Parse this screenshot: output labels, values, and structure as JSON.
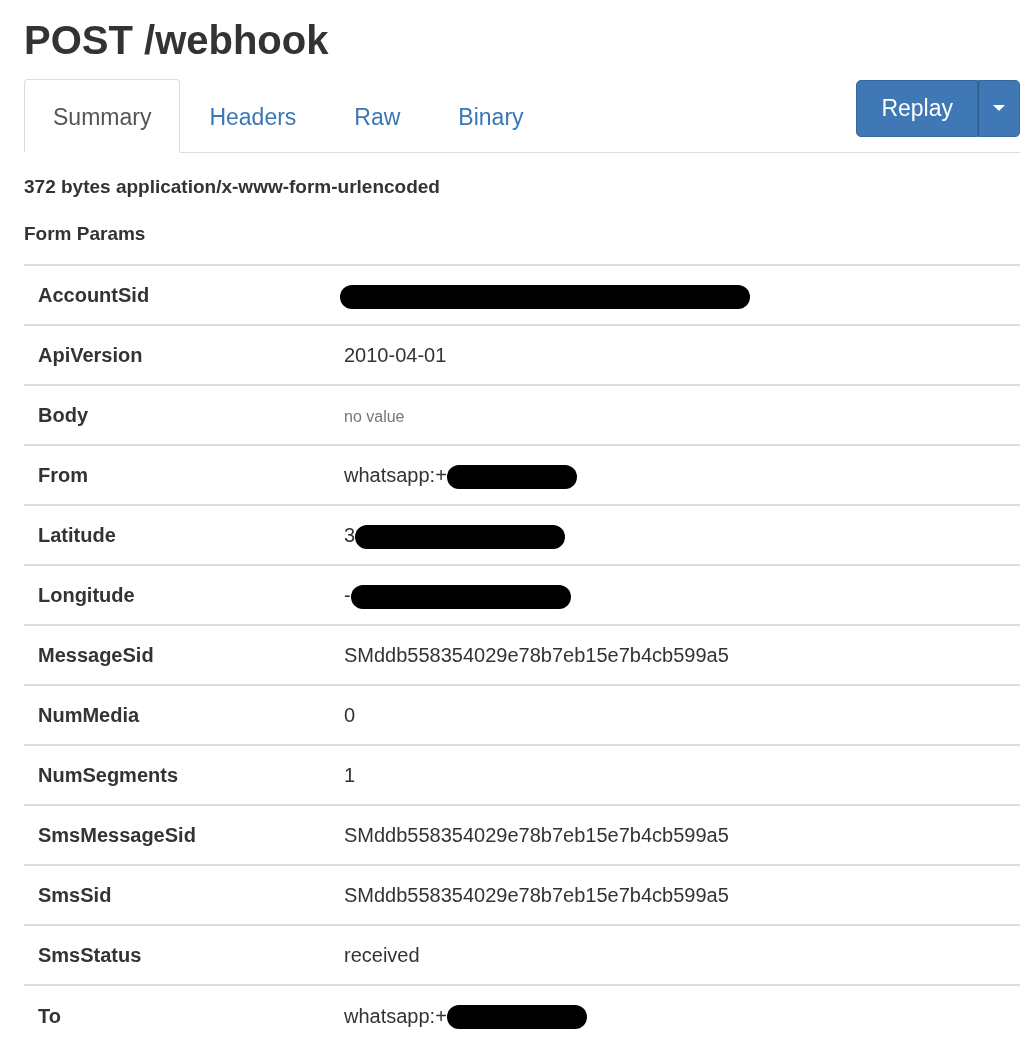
{
  "title": "POST /webhook",
  "tabs": [
    {
      "label": "Summary",
      "selected": true
    },
    {
      "label": "Headers",
      "selected": false
    },
    {
      "label": "Raw",
      "selected": false
    },
    {
      "label": "Binary",
      "selected": false
    }
  ],
  "replay_button": {
    "label": "Replay"
  },
  "content_summary": "372 bytes application/x-www-form-urlencoded",
  "section_title": "Form Params",
  "params": [
    {
      "name": "AccountSid",
      "kind": "redacted"
    },
    {
      "name": "ApiVersion",
      "kind": "text",
      "value": "2010-04-01"
    },
    {
      "name": "Body",
      "kind": "empty",
      "value": "no value"
    },
    {
      "name": "From",
      "kind": "redacted",
      "value": "whatsapp:+"
    },
    {
      "name": "Latitude",
      "kind": "redacted",
      "value": "3"
    },
    {
      "name": "Longitude",
      "kind": "redacted",
      "value": "-"
    },
    {
      "name": "MessageSid",
      "kind": "text",
      "value": "SMddb558354029e78b7eb15e7b4cb599a5"
    },
    {
      "name": "NumMedia",
      "kind": "text",
      "value": "0"
    },
    {
      "name": "NumSegments",
      "kind": "text",
      "value": "1"
    },
    {
      "name": "SmsMessageSid",
      "kind": "text",
      "value": "SMddb558354029e78b7eb15e7b4cb599a5"
    },
    {
      "name": "SmsSid",
      "kind": "text",
      "value": "SMddb558354029e78b7eb15e7b4cb599a5"
    },
    {
      "name": "SmsStatus",
      "kind": "text",
      "value": "received"
    },
    {
      "name": "To",
      "kind": "redacted",
      "value": "whatsapp:+"
    }
  ]
}
